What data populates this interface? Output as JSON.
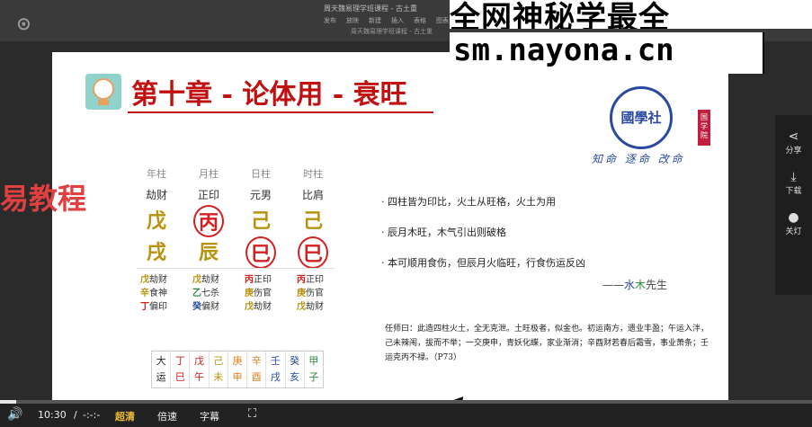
{
  "app": {
    "window_title": "周天魏易理学班课程 - 古土重",
    "window_subtitle": "周天魏易理学班课程 - 古土重",
    "toolbar": [
      "发布",
      "放映",
      "新建",
      "插入",
      "表格",
      "图表"
    ]
  },
  "watermark": {
    "title": "全网神秘学最全",
    "url": "sm.nayona.cn"
  },
  "slide": {
    "chapter_title": "第十章 - 论体用 - 衰旺",
    "seal_text": "國學社",
    "seal_tag": "国学院",
    "motto": "知命 逐命 改命",
    "side_big_text": "易教程",
    "pillars": [
      {
        "header": "年柱",
        "god": "劫财",
        "stem": "戊",
        "branch": "戌",
        "stem_ring": false,
        "branch_ring": false
      },
      {
        "header": "月柱",
        "god": "正印",
        "stem": "丙",
        "branch": "辰",
        "stem_ring": true,
        "branch_ring": false
      },
      {
        "header": "日柱",
        "god": "元男",
        "stem": "己",
        "branch": "巳",
        "stem_ring": false,
        "branch_ring": true
      },
      {
        "header": "时柱",
        "god": "比肩",
        "stem": "己",
        "branch": "巳",
        "stem_ring": false,
        "branch_ring": true
      }
    ],
    "hidden_stems": [
      [
        {
          "c": "戊",
          "t": "劫财",
          "color": "gold"
        },
        {
          "c": "辛",
          "t": "食神",
          "color": "gold"
        },
        {
          "c": "丁",
          "t": "偏印",
          "color": "red"
        }
      ],
      [
        {
          "c": "戊",
          "t": "劫财",
          "color": "gold"
        },
        {
          "c": "乙",
          "t": "七杀",
          "color": "green"
        },
        {
          "c": "癸",
          "t": "偏财",
          "color": "blue"
        }
      ],
      [
        {
          "c": "丙",
          "t": "正印",
          "color": "red"
        },
        {
          "c": "庚",
          "t": "伤官",
          "color": "gold"
        },
        {
          "c": "戊",
          "t": "劫财",
          "color": "gold"
        }
      ],
      [
        {
          "c": "丙",
          "t": "正印",
          "color": "red"
        },
        {
          "c": "庚",
          "t": "伤官",
          "color": "gold"
        },
        {
          "c": "戊",
          "t": "劫财",
          "color": "gold"
        }
      ]
    ],
    "dayun": [
      {
        "top": "大",
        "bottom": "运",
        "color": "#222"
      },
      {
        "top": "丁",
        "bottom": "巳",
        "color": "#d42020"
      },
      {
        "top": "戊",
        "bottom": "午",
        "color": "#d42020"
      },
      {
        "top": "己",
        "bottom": "未",
        "color": "#b8930e"
      },
      {
        "top": "庚",
        "bottom": "申",
        "color": "#e08020"
      },
      {
        "top": "辛",
        "bottom": "酉",
        "color": "#e08020"
      },
      {
        "top": "壬",
        "bottom": "戌",
        "color": "#2a4aa0"
      },
      {
        "top": "癸",
        "bottom": "亥",
        "color": "#2a4aa0"
      },
      {
        "top": "甲",
        "bottom": "子",
        "color": "#2a8a3a"
      }
    ],
    "notes": [
      "· 四柱皆为印比，火土从旺格，火土为用",
      "· 辰月木旺，木气引出则破格",
      "· 本可顺用食伤，但辰月火临旺，行食伤运反凶"
    ],
    "signature_prefix": "——",
    "signature_water": "水",
    "signature_wood": "木",
    "signature_suffix": "先生",
    "ren_text": "任师曰：此造四柱火土，全无克泄。土旺极者，似金也。初运南方，遗业丰盈；午运入泮，己未辣闱，拔而不举；一交庚申，青妖化蝶，家业渐消；辛酉财若春后霜雪，事业萧条；壬运克丙不禄。（P73）"
  },
  "side_panel": [
    {
      "icon": "share-icon",
      "glyph": "⋖",
      "label": "分享"
    },
    {
      "icon": "download-icon",
      "glyph": "⤓",
      "label": "下载"
    },
    {
      "icon": "bulb-icon",
      "glyph": "●",
      "label": "关灯"
    }
  ],
  "player": {
    "time_current": "10:30",
    "time_sep": "/",
    "time_total": "-:-:-",
    "quality": "超清",
    "speed": "倍速",
    "subtitle": "字幕",
    "progress": 0.02
  }
}
